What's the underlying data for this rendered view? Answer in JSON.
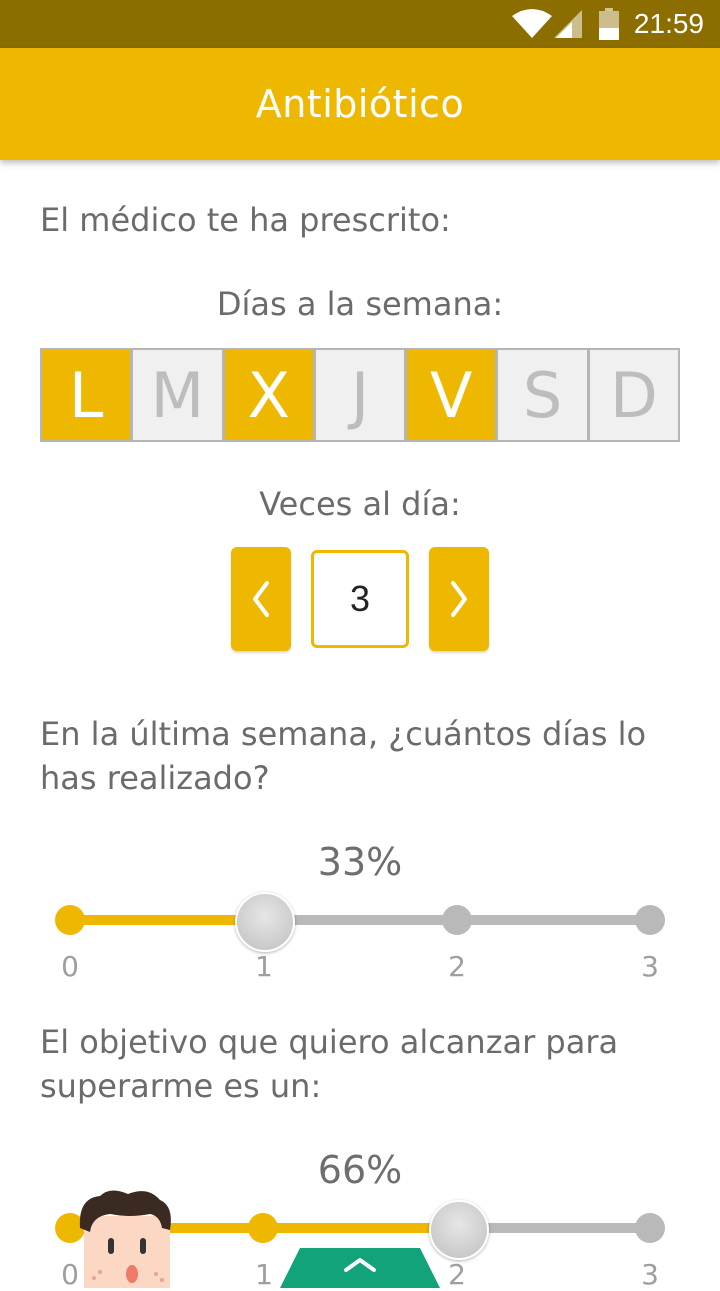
{
  "status_bar": {
    "time": "21:59",
    "icons": [
      "wifi-icon",
      "signal-icon",
      "battery-icon"
    ]
  },
  "app_bar": {
    "title": "Antibiótico"
  },
  "prescription": {
    "intro": "El médico te ha prescrito:",
    "days_label": "Días a la semana:",
    "days": [
      {
        "letter": "L",
        "selected": true
      },
      {
        "letter": "M",
        "selected": false
      },
      {
        "letter": "X",
        "selected": true
      },
      {
        "letter": "J",
        "selected": false
      },
      {
        "letter": "V",
        "selected": true
      },
      {
        "letter": "S",
        "selected": false
      },
      {
        "letter": "D",
        "selected": false
      }
    ],
    "times_label": "Veces al día:",
    "times_value": "3"
  },
  "adherence": {
    "question": "En la última semana, ¿cuántos días lo has realizado?",
    "percent": "33%",
    "ticks": [
      "0",
      "1",
      "2",
      "3"
    ],
    "value": 1
  },
  "goal": {
    "question": "El objetivo que quiero alcanzar para superarme es un:",
    "percent": "66%",
    "ticks": [
      "0",
      "1",
      "2",
      "3"
    ],
    "value": 2
  },
  "colors": {
    "accent": "#efb800",
    "status_bar": "#8c6d00",
    "inactive": "#b9b9b9",
    "text": "#6b6b6b"
  }
}
